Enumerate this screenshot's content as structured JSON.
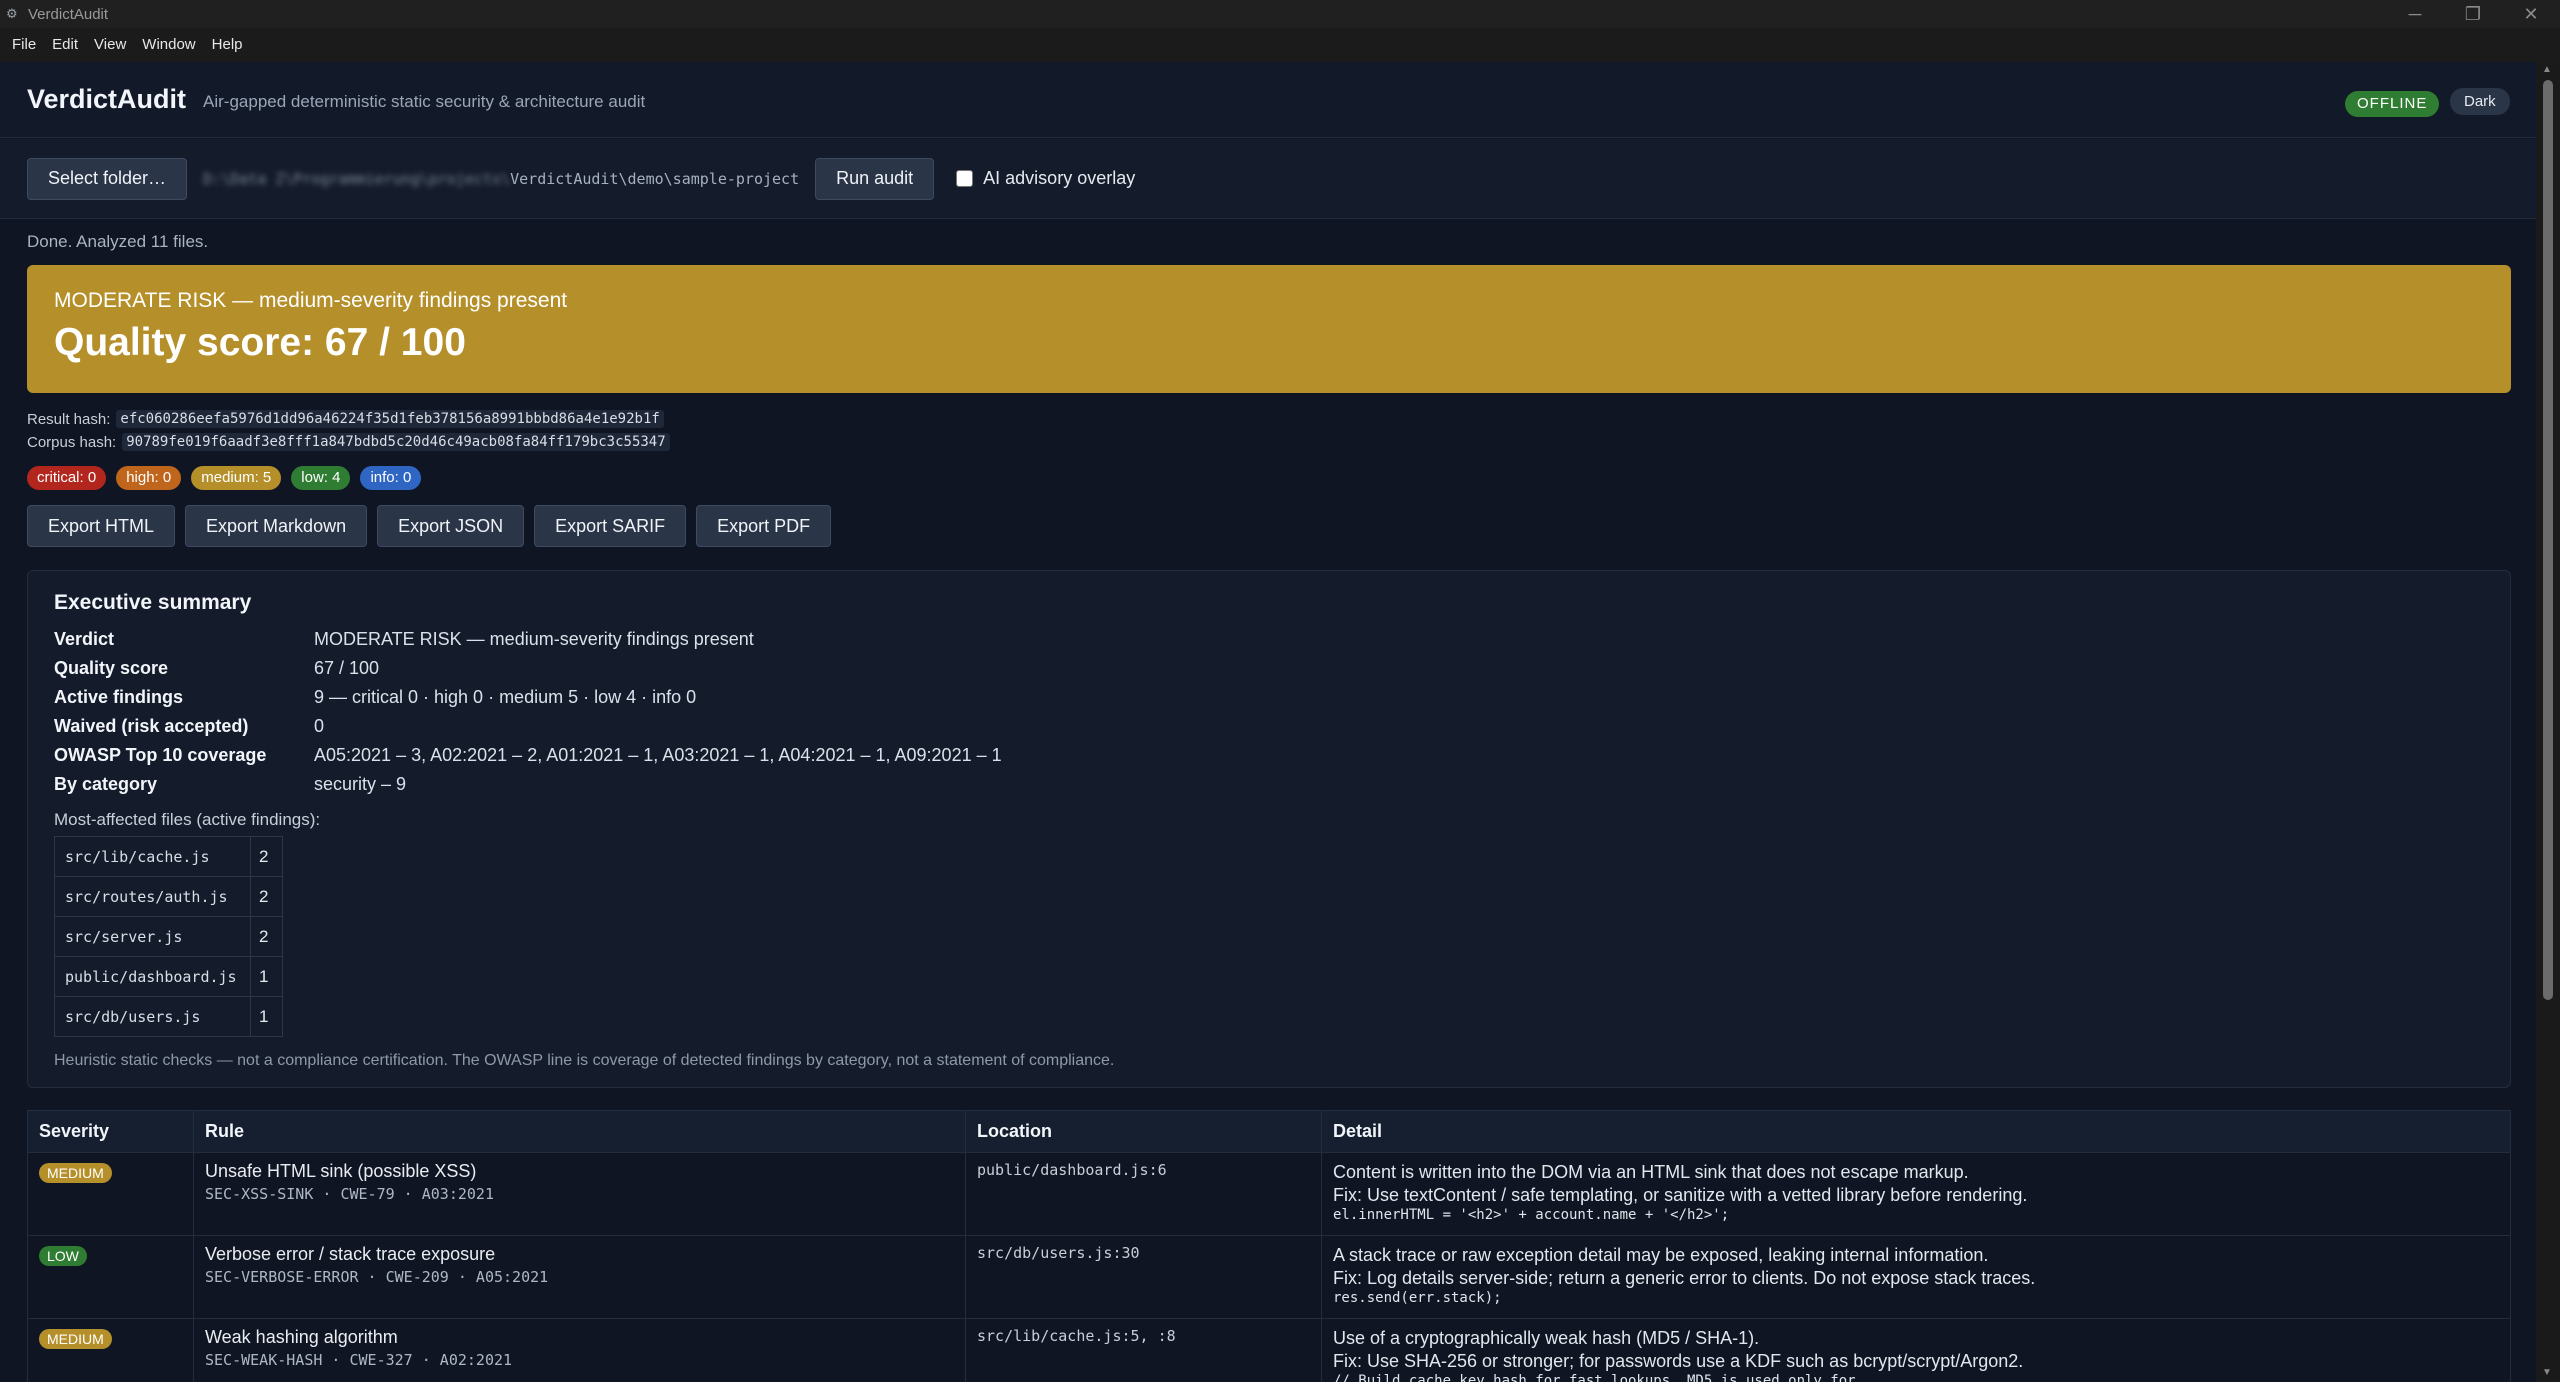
{
  "window": {
    "title": "VerdictAudit",
    "controls": [
      "─",
      "❐",
      "✕"
    ]
  },
  "menu": [
    "File",
    "Edit",
    "View",
    "Window",
    "Help"
  ],
  "header": {
    "app_name": "VerdictAudit",
    "tagline": "Air-gapped deterministic static security & architecture audit",
    "status_badge": "OFFLINE",
    "theme_button": "Dark"
  },
  "toolbar": {
    "select_folder_label": "Select folder…",
    "path_prefix_redacted": "D:\\Data Z\\Programmierung\\projects\\",
    "path_visible": "VerdictAudit\\demo\\sample-project",
    "run_label": "Run audit",
    "ai_overlay_label": "AI advisory overlay",
    "ai_overlay_checked": false
  },
  "status": "Done. Analyzed 11 files.",
  "verdict": {
    "text": "MODERATE RISK — medium-severity findings present",
    "score_text": "Quality score: 67 / 100",
    "color": "#b48f2a"
  },
  "hashes": {
    "result_label": "Result hash:",
    "result_value": "efc060286eefa5976d1dd96a46224f35d1feb378156a8991bbbd86a4e1e92b1f",
    "corpus_label": "Corpus hash:",
    "corpus_value": "90789fe019f6aadf3e8fff1a847bdbd5c20d46c49acb08fa84ff179bc3c55347"
  },
  "severity_counts": [
    {
      "label": "critical: 0",
      "level": "critical"
    },
    {
      "label": "high: 0",
      "level": "high"
    },
    {
      "label": "medium: 5",
      "level": "medium"
    },
    {
      "label": "low: 4",
      "level": "low"
    },
    {
      "label": "info: 0",
      "level": "info"
    }
  ],
  "exports": [
    "Export HTML",
    "Export Markdown",
    "Export JSON",
    "Export SARIF",
    "Export PDF"
  ],
  "summary": {
    "title": "Executive summary",
    "rows": [
      {
        "k": "Verdict",
        "v": "MODERATE RISK — medium-severity findings present"
      },
      {
        "k": "Quality score",
        "v": "67 / 100"
      },
      {
        "k": "Active findings",
        "v": "9 — critical 0 · high 0 · medium 5 · low 4 · info 0"
      },
      {
        "k": "Waived (risk accepted)",
        "v": "0"
      },
      {
        "k": "OWASP Top 10 coverage",
        "v": "A05:2021 – 3, A02:2021 – 2, A01:2021 – 1, A03:2021 – 1, A04:2021 – 1, A09:2021 – 1"
      },
      {
        "k": "By category",
        "v": "security – 9"
      }
    ],
    "most_affected_label": "Most-affected files (active findings):",
    "files": [
      {
        "path": "src/lib/cache.js",
        "count": "2"
      },
      {
        "path": "src/routes/auth.js",
        "count": "2"
      },
      {
        "path": "src/server.js",
        "count": "2"
      },
      {
        "path": "public/dashboard.js",
        "count": "1"
      },
      {
        "path": "src/db/users.js",
        "count": "1"
      }
    ],
    "disclaimer": "Heuristic static checks — not a compliance certification. The OWASP line is coverage of detected findings by category, not a statement of compliance."
  },
  "findings": {
    "headers": [
      "Severity",
      "Rule",
      "Location",
      "Detail"
    ],
    "rows": [
      {
        "severity": "MEDIUM",
        "rule": "Unsafe HTML sink (possible XSS)",
        "meta": "SEC-XSS-SINK · CWE-79 · A03:2021",
        "location": "public/dashboard.js:6",
        "detail": "Content is written into the DOM via an HTML sink that does not escape markup.",
        "fix": "Fix: Use textContent / safe templating, or sanitize with a vetted library before rendering.",
        "code": "el.innerHTML = '<h2>' + account.name + '</h2>';"
      },
      {
        "severity": "LOW",
        "rule": "Verbose error / stack trace exposure",
        "meta": "SEC-VERBOSE-ERROR · CWE-209 · A05:2021",
        "location": "src/db/users.js:30",
        "detail": "A stack trace or raw exception detail may be exposed, leaking internal information.",
        "fix": "Fix: Log details server-side; return a generic error to clients. Do not expose stack traces.",
        "code": "res.send(err.stack);"
      },
      {
        "severity": "MEDIUM",
        "rule": "Weak hashing algorithm",
        "meta": "SEC-WEAK-HASH · CWE-327 · A02:2021",
        "location": "src/lib/cache.js:5, :8",
        "detail": "Use of a cryptographically weak hash (MD5 / SHA-1).",
        "fix": "Fix: Use SHA-256 or stronger; for passwords use a KDF such as bcrypt/scrypt/Argon2.",
        "code": "// Build cache key hash for fast lookups. MD5 is used only for..."
      }
    ]
  }
}
